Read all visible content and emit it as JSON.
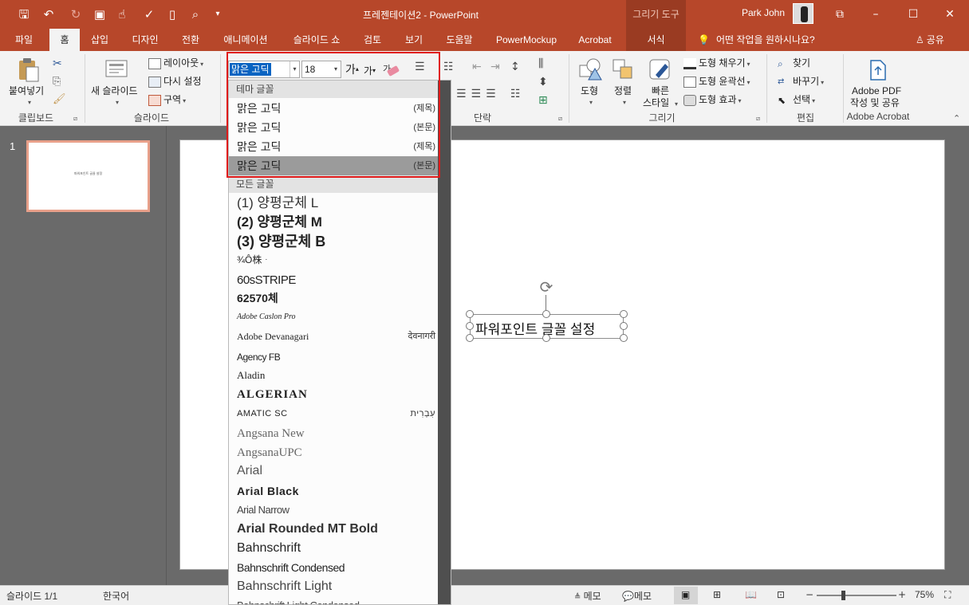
{
  "app": {
    "title": "프레젠테이션2 - PowerPoint",
    "context_tab_group": "그리기 도구",
    "user": "Park John"
  },
  "colors": {
    "accent": "#b7472a",
    "highlight_box": "#e01b1b",
    "selected_item": "#9b9b9b"
  },
  "tabs": [
    {
      "label": "파일"
    },
    {
      "label": "홈"
    },
    {
      "label": "삽입"
    },
    {
      "label": "디자인"
    },
    {
      "label": "전환"
    },
    {
      "label": "애니메이션"
    },
    {
      "label": "슬라이드 쇼"
    },
    {
      "label": "검토"
    },
    {
      "label": "보기"
    },
    {
      "label": "도움말"
    },
    {
      "label": "PowerMockup"
    },
    {
      "label": "Acrobat"
    },
    {
      "label": "서식"
    }
  ],
  "tellme": "어떤 작업을 원하시나요?",
  "share": "공유",
  "ribbon": {
    "clipboard": {
      "paste": "붙여넣기",
      "label": "클립보드"
    },
    "slides": {
      "new_slide": "새 슬라이드",
      "layout": "레이아웃",
      "reset": "다시 설정",
      "section": "구역",
      "label": "슬라이드"
    },
    "font": {
      "name": "맑은 고딕",
      "size": "18",
      "grow": "가",
      "shrink": "가"
    },
    "paragraph": {
      "label": "단락"
    },
    "drawing": {
      "shapes": "도형",
      "arrange": "정렬",
      "quick_styles_1": "빠른",
      "quick_styles_2": "스타일",
      "fill": "도형 채우기",
      "outline": "도형 윤곽선",
      "effects": "도형 효과",
      "label": "그리기"
    },
    "editing": {
      "find": "찾기",
      "replace": "바꾸기",
      "select": "선택",
      "label": "편집"
    },
    "acrobat": {
      "line1": "Adobe PDF",
      "line2": "작성 및 공유",
      "label": "Adobe Acrobat"
    }
  },
  "font_dropdown": {
    "theme_header": "테마 글꼴",
    "theme_fonts": [
      {
        "name": "맑은 고딕",
        "tag": "(제목)"
      },
      {
        "name": "맑은 고딕",
        "tag": "(본문)"
      },
      {
        "name": "맑은 고딕",
        "tag": "(제목)"
      },
      {
        "name": "맑은 고딕",
        "tag": "(본문)"
      }
    ],
    "all_header": "모든 글꼴",
    "all_fonts": [
      {
        "name": "(1) 양평군체 L"
      },
      {
        "name": "(2) 양평군체 M"
      },
      {
        "name": "(3) 양평군체 B"
      },
      {
        "name": "¾Ô株ᆞ"
      },
      {
        "name": "60sSTRIPE"
      },
      {
        "name": "62570체"
      },
      {
        "name": "Adobe Caslon Pro"
      },
      {
        "name": "Adobe Devanagari",
        "preview": "देवनागरी"
      },
      {
        "name": "Agency FB"
      },
      {
        "name": "Aladin"
      },
      {
        "name": "ALGERIAN"
      },
      {
        "name": "AMATIC SC",
        "preview": "עִבְרִית"
      },
      {
        "name": "Angsana New"
      },
      {
        "name": "AngsanaUPC"
      },
      {
        "name": "Arial"
      },
      {
        "name": "Arial Black"
      },
      {
        "name": "Arial Narrow"
      },
      {
        "name": "Arial Rounded MT Bold"
      },
      {
        "name": "Bahnschrift"
      },
      {
        "name": "Bahnschrift Condensed"
      },
      {
        "name": "Bahnschrift Light"
      },
      {
        "name": "Bahnschrift Light Condensed"
      }
    ]
  },
  "slide_panel": {
    "number": "1",
    "thumb_text": "파워포인트 글꼴 설정"
  },
  "slide": {
    "textbox": "파워포인트 글꼴 설정"
  },
  "status": {
    "slide": "슬라이드 1/1",
    "language": "한국어",
    "notes": "메모",
    "comments": "메모",
    "zoom": "75%",
    "zoom_level": 0.5
  }
}
